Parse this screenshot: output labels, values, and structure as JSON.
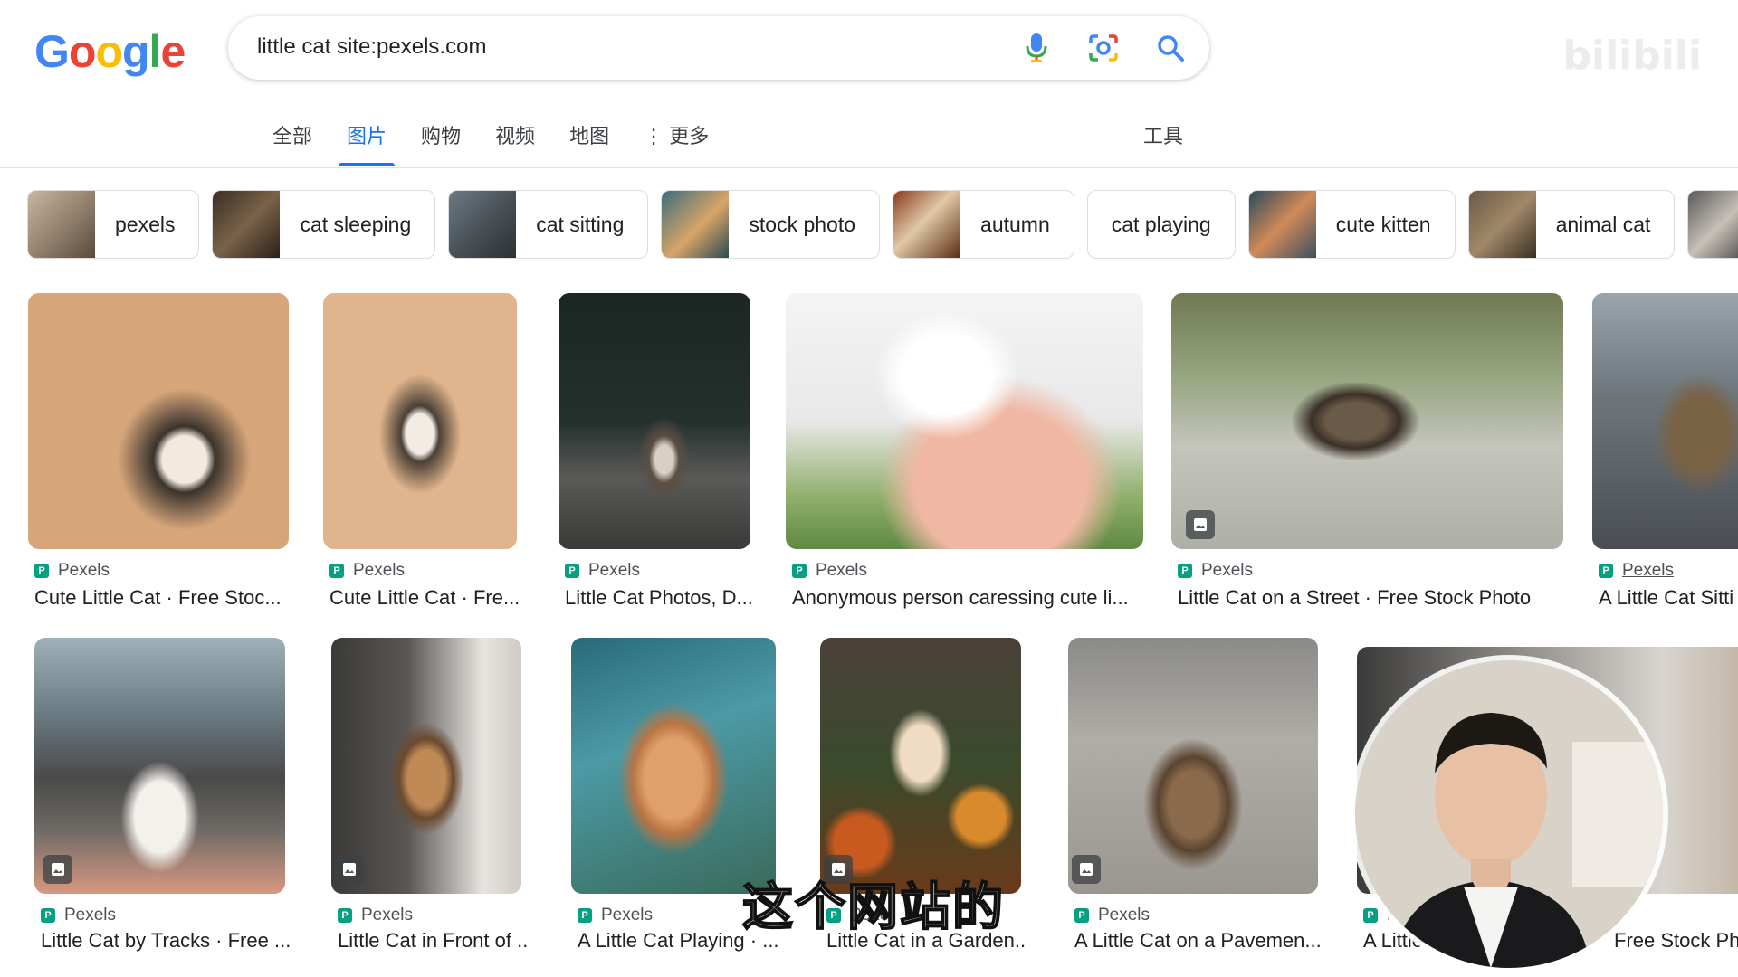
{
  "search": {
    "query": "little cat site:pexels.com"
  },
  "logo": {
    "letters": [
      "G",
      "o",
      "o",
      "g",
      "l",
      "e"
    ],
    "colors": [
      "#4285F4",
      "#EA4335",
      "#FBBC05",
      "#4285F4",
      "#34A853",
      "#EA4335"
    ]
  },
  "watermark": "bilibili",
  "tabs": [
    {
      "label": "全部"
    },
    {
      "label": "图片"
    },
    {
      "label": "购物"
    },
    {
      "label": "视频"
    },
    {
      "label": "地图"
    },
    {
      "label": "⋮ 更多"
    }
  ],
  "tools_label": "工具",
  "chips": [
    {
      "label": "pexels"
    },
    {
      "label": "cat sleeping"
    },
    {
      "label": "cat sitting"
    },
    {
      "label": "stock photo"
    },
    {
      "label": "autumn"
    },
    {
      "label": "cat playing"
    },
    {
      "label": "cute kitten"
    },
    {
      "label": "animal cat"
    }
  ],
  "results": [
    {
      "source": "Pexels",
      "title": "Cute Little Cat · Free Stoc..."
    },
    {
      "source": "Pexels",
      "title": "Cute Little Cat · Fre..."
    },
    {
      "source": "Pexels",
      "title": "Little Cat Photos, D..."
    },
    {
      "source": "Pexels",
      "title": "Anonymous person caressing cute li..."
    },
    {
      "source": "Pexels",
      "title": "Little Cat on a Street · Free Stock Photo"
    },
    {
      "source": "Pexels",
      "title": "A Little Cat Sitti"
    },
    {
      "source": "Pexels",
      "title": "Little Cat by Tracks · Free ..."
    },
    {
      "source": "Pexels",
      "title": "Little Cat in Front of ..."
    },
    {
      "source": "Pexels",
      "title": "A Little Cat Playing · ..."
    },
    {
      "source": "Pexe",
      "title": "Little Cat in a Garden..."
    },
    {
      "source": "Pexels",
      "title": "A Little Cat on a Pavemen..."
    },
    {
      "source": "Pe",
      "title": "A Little"
    }
  ],
  "partial_title_right": "Free Stock Ph",
  "subtitle": "这个网站的",
  "colors": {
    "accent": "#1a73e8",
    "favicon": "#05a081"
  }
}
